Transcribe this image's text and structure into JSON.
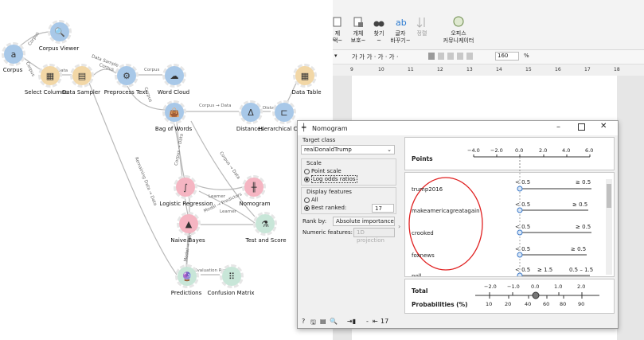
{
  "canvas": {
    "nodes": [
      {
        "id": "corpus",
        "label": "Corpus",
        "glyph": "a",
        "color": "#a8c8e8"
      },
      {
        "id": "corpus-viewer",
        "label": "Corpus Viewer",
        "glyph": "🔍",
        "color": "#a8c8e8"
      },
      {
        "id": "select-columns",
        "label": "Select Columns",
        "glyph": "▦",
        "color": "#f2d7a6"
      },
      {
        "id": "data-sampler",
        "label": "Data Sampler",
        "glyph": "▤",
        "color": "#f2d7a6"
      },
      {
        "id": "preprocess-text",
        "label": "Preprocess Text",
        "glyph": "⚙",
        "color": "#a8c8e8"
      },
      {
        "id": "word-cloud",
        "label": "Word Cloud",
        "glyph": "☁",
        "color": "#a8c8e8"
      },
      {
        "id": "data-table",
        "label": "Data Table",
        "glyph": "▦",
        "color": "#f2d7a6"
      },
      {
        "id": "bag-of-words",
        "label": "Bag of Words",
        "glyph": "👜",
        "color": "#a8c8e8"
      },
      {
        "id": "distances",
        "label": "Distances",
        "glyph": "Δ",
        "color": "#a8c8e8"
      },
      {
        "id": "hierarchical-clustering",
        "label": "Hierarchical Clus",
        "glyph": "⊏",
        "color": "#a8c8e8"
      },
      {
        "id": "logistic-regression",
        "label": "Logistic Regression",
        "glyph": "∫",
        "color": "#f5b5c2"
      },
      {
        "id": "nomogram",
        "label": "Nomogram",
        "glyph": "╫",
        "color": "#f5b5c2"
      },
      {
        "id": "naive-bayes",
        "label": "Naive Bayes",
        "glyph": "▲",
        "color": "#f5b5c2"
      },
      {
        "id": "test-and-score",
        "label": "Test and Score",
        "glyph": "⚗",
        "color": "#c8e6d8"
      },
      {
        "id": "predictions",
        "label": "Predictions",
        "glyph": "🔮",
        "color": "#c8e6d8"
      },
      {
        "id": "confusion-matrix",
        "label": "Confusion Matrix",
        "glyph": "⠿",
        "color": "#c8e6d8"
      }
    ],
    "edges": [
      "Corpus",
      "Corpus",
      "Data",
      "Data Sample",
      "Corpus",
      "Corpus",
      "Corpus",
      "Corpus → Data",
      "Distances",
      "Remaining Data → Data",
      "Corpus → Data",
      "Corpus → Data",
      "Learner",
      "Model → Predictors",
      "Learner",
      "Model → Predictors",
      "Evaluation Results"
    ]
  },
  "ribbon": {
    "buttons": [
      {
        "line1": "제",
        "line2": "택~"
      },
      {
        "line1": "개체",
        "line2": "보호~"
      },
      {
        "line1": "찾기",
        "line2": "~"
      },
      {
        "line1": "글자",
        "line2": "바꾸기~"
      },
      {
        "line1": "정렬",
        "line2": ""
      },
      {
        "line1": "오피스",
        "line2": "커뮤니케이터"
      }
    ],
    "format": {
      "font_styles": "가 가 가 · 가 · 가 ·",
      "zoom": "160",
      "unit": "%"
    },
    "ruler_ticks": [
      "9",
      "10",
      "11",
      "12",
      "13",
      "14",
      "15",
      "16",
      "17",
      "18"
    ]
  },
  "nomogram": {
    "title": "Nomogram",
    "target_class": {
      "label": "Target class",
      "value": "realDonaldTrump"
    },
    "scale": {
      "label": "Scale",
      "options": [
        "Point scale",
        "Log odds ratios"
      ],
      "selected": 1
    },
    "display_features": {
      "label": "Display features",
      "options": [
        "All",
        "Best ranked:"
      ],
      "selected": 1,
      "best_ranked_value": "17"
    },
    "rank_by": {
      "label": "Rank by:",
      "value": "Absolute importance"
    },
    "numeric_features": {
      "label": "Numeric features:",
      "value": "1D projection"
    },
    "points_axis": {
      "label": "Points",
      "ticks": [
        "−4.0",
        "−2.0",
        "0.0",
        "2.0",
        "4.0",
        "6.0"
      ]
    },
    "features": [
      {
        "name": "trump2016",
        "left": "< 0.5",
        "right": "≥ 0.5"
      },
      {
        "name": "makeamericagreatagain",
        "left": "< 0.5",
        "right": "≥ 0.5"
      },
      {
        "name": "crooked",
        "left": "< 0.5",
        "right": "≥ 0.5"
      },
      {
        "name": "foxnews",
        "left": "< 0.5",
        "right": "≥ 0.5"
      },
      {
        "name": "poll",
        "left": "< 0.5",
        "mid": "≥ 1.5",
        "right": "0.5 – 1.5"
      }
    ],
    "total": {
      "label": "Total",
      "ticks": [
        "−2.0",
        "−1.0",
        "0.0",
        "1.0",
        "2.0"
      ]
    },
    "probabilities": {
      "label": "Probabilities (%)",
      "ticks": [
        "10",
        "20",
        "40",
        "60",
        "80",
        "90"
      ]
    },
    "statusbar": {
      "count": "17"
    }
  }
}
